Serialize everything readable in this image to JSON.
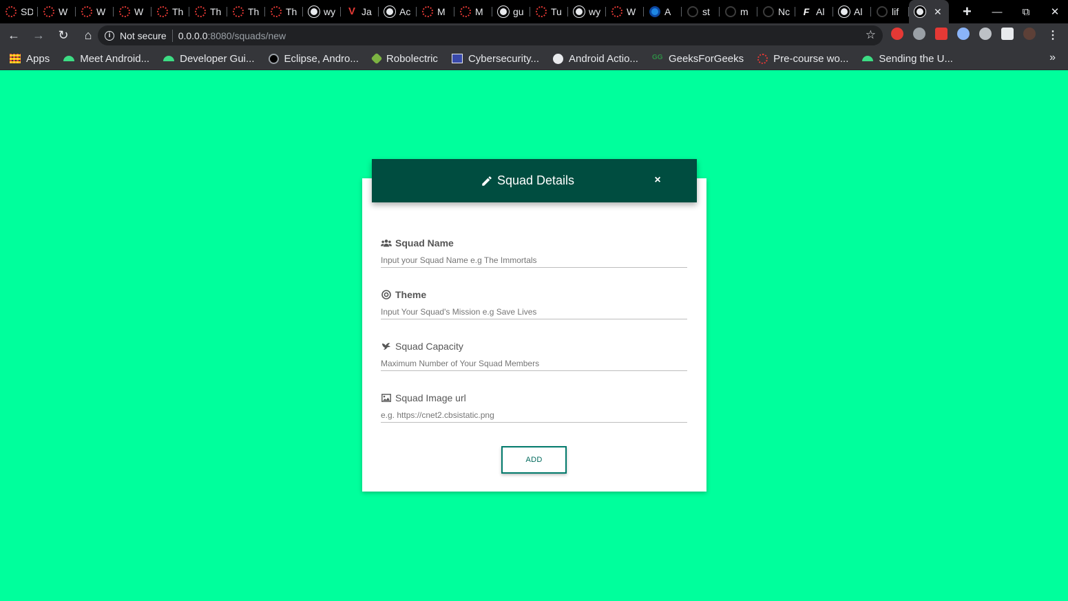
{
  "browser": {
    "tabs": [
      {
        "label": "SD",
        "icon": "red-dotted-circle-icon"
      },
      {
        "label": "W",
        "icon": "red-dotted-circle-icon"
      },
      {
        "label": "W",
        "icon": "red-dotted-circle-icon"
      },
      {
        "label": "W",
        "icon": "red-dotted-circle-icon"
      },
      {
        "label": "Th",
        "icon": "red-dotted-circle-icon"
      },
      {
        "label": "Th",
        "icon": "red-dotted-circle-icon"
      },
      {
        "label": "Th",
        "icon": "red-dotted-circle-icon"
      },
      {
        "label": "Th",
        "icon": "red-dotted-circle-icon"
      },
      {
        "label": "wy",
        "icon": "globe-icon"
      },
      {
        "label": "Ja",
        "icon": "v-icon"
      },
      {
        "label": "Ac",
        "icon": "globe-icon"
      },
      {
        "label": "M",
        "icon": "red-dotted-circle-icon"
      },
      {
        "label": "M",
        "icon": "red-dotted-circle-icon"
      },
      {
        "label": "gu",
        "icon": "globe-icon"
      },
      {
        "label": "Tu",
        "icon": "red-dotted-circle-icon"
      },
      {
        "label": "wy",
        "icon": "globe-icon"
      },
      {
        "label": "W",
        "icon": "red-dotted-circle-icon"
      },
      {
        "label": "A",
        "icon": "blue-circle-icon"
      },
      {
        "label": "st",
        "icon": "github-icon"
      },
      {
        "label": "m",
        "icon": "github-icon"
      },
      {
        "label": "Nc",
        "icon": "github-icon"
      },
      {
        "label": "Al",
        "icon": "f-icon"
      },
      {
        "label": "Al",
        "icon": "globe-icon"
      },
      {
        "label": "lif",
        "icon": "github-icon"
      }
    ],
    "active_tab_close": "✕",
    "new_tab": "+",
    "window_controls": {
      "minimize": "—",
      "restore": "⧉",
      "close": "✕"
    },
    "nav": {
      "back": "←",
      "forward": "→",
      "reload": "↻",
      "home": "⌂"
    },
    "security_label": "Not secure",
    "url_host": "0.0.0.0",
    "url_path": ":8080/squads/new",
    "bookmarks": [
      {
        "label": "Apps",
        "icon": "apps-grid-icon"
      },
      {
        "label": "Meet Android...",
        "icon": "android-icon"
      },
      {
        "label": "Developer Gui...",
        "icon": "android-icon"
      },
      {
        "label": "Eclipse, Andro...",
        "icon": "eclipse-icon"
      },
      {
        "label": "Robolectric",
        "icon": "robolectric-icon"
      },
      {
        "label": "Cybersecurity...",
        "icon": "cybersecurity-icon"
      },
      {
        "label": "Android Actio...",
        "icon": "globe-icon"
      },
      {
        "label": "GeeksForGeeks",
        "icon": "gfg-icon"
      },
      {
        "label": "Pre-course wo...",
        "icon": "red-dotted-circle-icon"
      },
      {
        "label": "Sending the U...",
        "icon": "android-icon"
      }
    ],
    "bookmarks_more": "»"
  },
  "modal": {
    "title": "Squad Details",
    "close_label": "×",
    "fields": {
      "name": {
        "label": "Squad Name",
        "placeholder": "Input your Squad Name e.g The Immortals",
        "value": ""
      },
      "theme": {
        "label": "Theme",
        "placeholder": "Input Your Squad's Mission e.g Save Lives",
        "value": ""
      },
      "capacity": {
        "label": "Squad Capacity",
        "placeholder": "Maximum Number of Your Squad Members",
        "value": ""
      },
      "image": {
        "label": "Squad Image url",
        "placeholder": "e.g. https://cnet2.cbsistatic.png",
        "value": ""
      }
    },
    "submit_label": "ADD"
  },
  "colors": {
    "page_background": "#00ff9c",
    "header_background": "#004d40",
    "button_border": "#00796b"
  }
}
